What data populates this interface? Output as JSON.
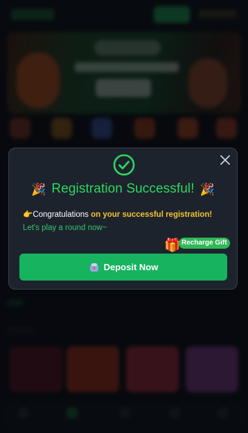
{
  "modal": {
    "title": "Registration Successful!",
    "message_part1": "Congratulations ",
    "message_part2": "on your successful registration!",
    "message_part3": " Let's play a round now~",
    "gift_label": "Recharge Gift",
    "deposit_label": "Deposit Now"
  },
  "colors": {
    "accent_green": "#2fd860",
    "button_green": "#17b35f",
    "highlight_yellow": "#f1c332",
    "modal_bg": "#1d232d"
  },
  "icons": {
    "close": "close-icon",
    "success": "check-circle-icon",
    "celebrate": "party-popper-icon",
    "point": "pointing-hand-icon",
    "gift": "gift-icon",
    "deposit": "wallet-icon"
  }
}
